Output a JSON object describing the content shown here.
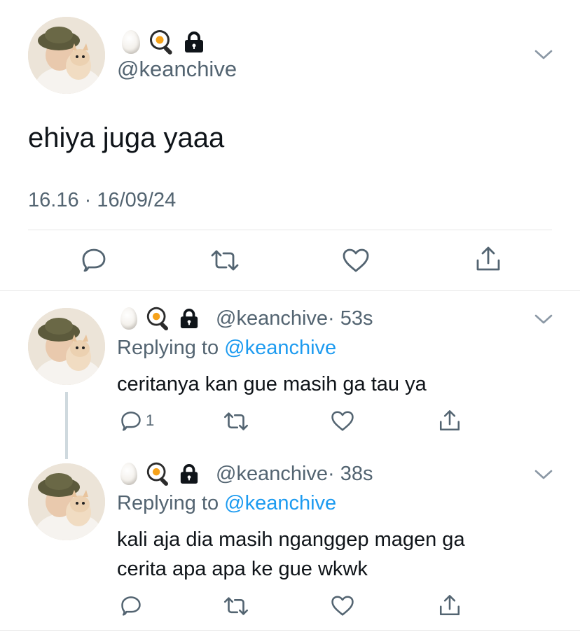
{
  "main_tweet": {
    "handle": "@keanchive",
    "text": "ehiya juga yaaa",
    "timestamp": "16.16 · 16/09/24",
    "actions": [
      "reply-icon",
      "retweet-icon",
      "like-icon",
      "share-icon"
    ]
  },
  "replies": [
    {
      "handle": "@keanchive",
      "time": "· 53s",
      "replying_prefix": "Replying to",
      "replying_to": "@keanchive",
      "text_lines": [
        "ceritanya kan gue masih ga tau ya"
      ],
      "reply_count": "1"
    },
    {
      "handle": "@keanchive",
      "time": "· 38s",
      "replying_prefix": "Replying to",
      "replying_to": "@keanchive",
      "text_lines": [
        "kali aja dia masih nganggep magen ga",
        "cerita apa apa ke gue wkwk"
      ],
      "reply_count": ""
    }
  ],
  "name_emojis": [
    "egg",
    "frying-pan-egg",
    "lock"
  ],
  "colors": {
    "text": "#0f1419",
    "muted": "#536471",
    "link": "#1d9bf0",
    "divider": "#e6e6e6",
    "thread_line": "#cfd9de"
  }
}
